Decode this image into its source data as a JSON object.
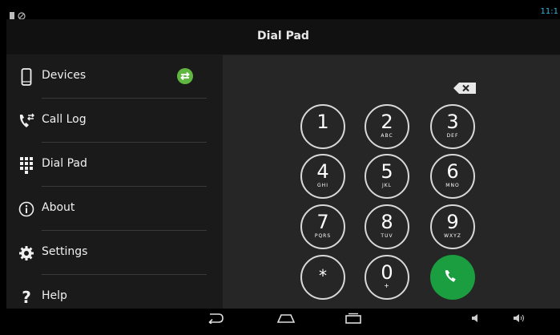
{
  "status_bar": {
    "time": "11:1",
    "icons": [
      "sd-card-icon",
      "no-signal-icon"
    ]
  },
  "header": {
    "title": "Dial Pad"
  },
  "sidebar": {
    "items": [
      {
        "label": "Devices",
        "icon": "phone-device-icon"
      },
      {
        "label": "Call Log",
        "icon": "call-log-icon"
      },
      {
        "label": "Dial Pad",
        "icon": "dialpad-icon"
      },
      {
        "label": "About",
        "icon": "info-icon"
      },
      {
        "label": "Settings",
        "icon": "gear-icon"
      },
      {
        "label": "Help",
        "icon": "question-icon"
      }
    ],
    "devices_status_icon": "sync-arrows-icon"
  },
  "dialpad": {
    "keys": [
      {
        "digit": "1",
        "letters": ""
      },
      {
        "digit": "2",
        "letters": "ABC"
      },
      {
        "digit": "3",
        "letters": "DEF"
      },
      {
        "digit": "4",
        "letters": "GHI"
      },
      {
        "digit": "5",
        "letters": "JKL"
      },
      {
        "digit": "6",
        "letters": "MNO"
      },
      {
        "digit": "7",
        "letters": "PQRS"
      },
      {
        "digit": "8",
        "letters": "TUV"
      },
      {
        "digit": "9",
        "letters": "WXYZ"
      },
      {
        "digit": "*",
        "letters": ""
      },
      {
        "digit": "0",
        "letters": "+"
      }
    ],
    "call_icon": "phone-call-icon",
    "backspace_icon": "backspace-icon"
  },
  "nav_bar": {
    "icons": [
      "back-icon",
      "home-icon",
      "recent-apps-icon",
      "volume-down-icon",
      "volume-up-icon"
    ]
  },
  "colors": {
    "call_green": "#1a9e3f",
    "sync_green": "#5fb640",
    "accent_blue": "#33b5e5"
  }
}
